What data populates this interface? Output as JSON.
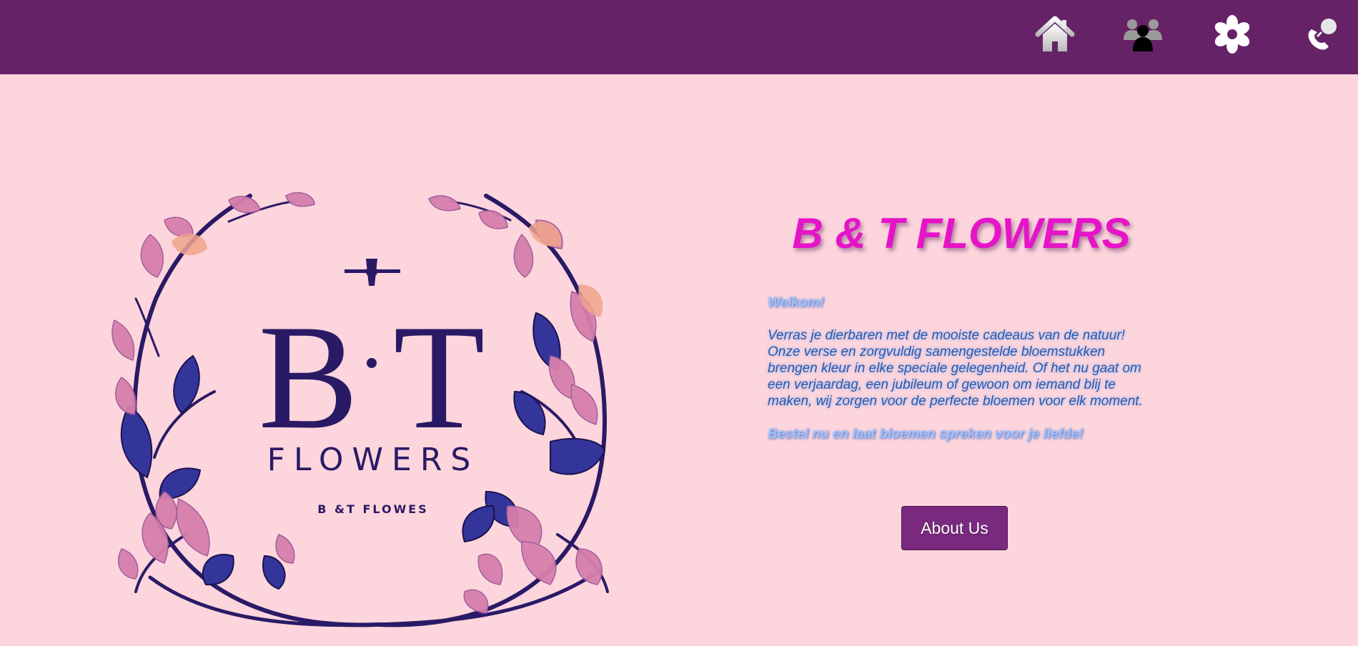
{
  "nav": {
    "items": [
      {
        "name": "home",
        "icon": "home-icon"
      },
      {
        "name": "team",
        "icon": "people-icon"
      },
      {
        "name": "flowers",
        "icon": "flower-icon"
      },
      {
        "name": "contact",
        "icon": "phone-icon"
      }
    ]
  },
  "logo": {
    "monogram": "B T",
    "wordmark": "FLOWERS",
    "tagline": "B &T FLOWES"
  },
  "hero": {
    "title": "B & T FLOWERS",
    "welcome": "Welkom!",
    "body": "Verras je dierbaren met de mooiste cadeaus van de natuur! Onze verse en zorgvuldig samengestelde bloemstukken brengen kleur in elke speciale gelegenheid. Of het nu gaat om een verjaardag, een jubileum of gewoon om iemand blij te maken, wij zorgen voor de perfecte bloemen voor elk moment.",
    "cta": "Bestel nu en laat bloemen spreken voor je liefde!",
    "button_label": "About Us"
  },
  "colors": {
    "topbar": "#662266",
    "background": "#fdd5dc",
    "title": "#e614c8",
    "button": "#7a2a7e",
    "logo_ink": "#2a1a66",
    "leaf_blue": "#33359a",
    "leaf_pink": "#d77fac"
  }
}
